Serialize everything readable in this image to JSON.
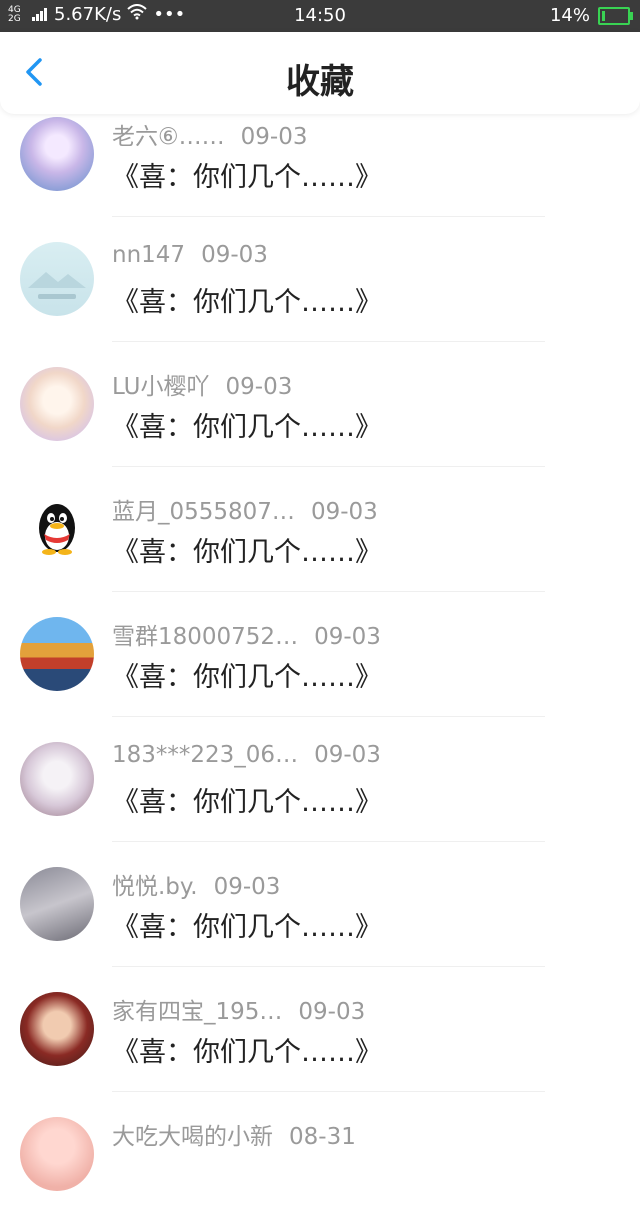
{
  "status_bar": {
    "network": "4G 2G",
    "speed": "5.67K/s",
    "time": "14:50",
    "battery": "14%",
    "battery_level": 0.14,
    "battery_color": "#39d353"
  },
  "header": {
    "title": "收藏",
    "back_icon": "chevron-left-icon",
    "accent": "#2196f3"
  },
  "items": [
    {
      "name": "老六⑥……",
      "date": "09-03",
      "text": "《喜：你们几个……》"
    },
    {
      "name": "nn147",
      "date": "09-03",
      "text": "《喜：你们几个……》"
    },
    {
      "name": "LU小樱吖",
      "date": "09-03",
      "text": "《喜：你们几个……》"
    },
    {
      "name": "蓝月_0555807…",
      "date": "09-03",
      "text": "《喜：你们几个……》"
    },
    {
      "name": "雪群18000752…",
      "date": "09-03",
      "text": "《喜：你们几个……》"
    },
    {
      "name": "183***223_06…",
      "date": "09-03",
      "text": "《喜：你们几个……》"
    },
    {
      "name": "悦悦.by.",
      "date": "09-03",
      "text": "《喜：你们几个……》"
    },
    {
      "name": "家有四宝_195…",
      "date": "09-03",
      "text": "《喜：你们几个……》"
    },
    {
      "name": "大吃大喝的小新",
      "date": "08-31",
      "text": ""
    }
  ]
}
